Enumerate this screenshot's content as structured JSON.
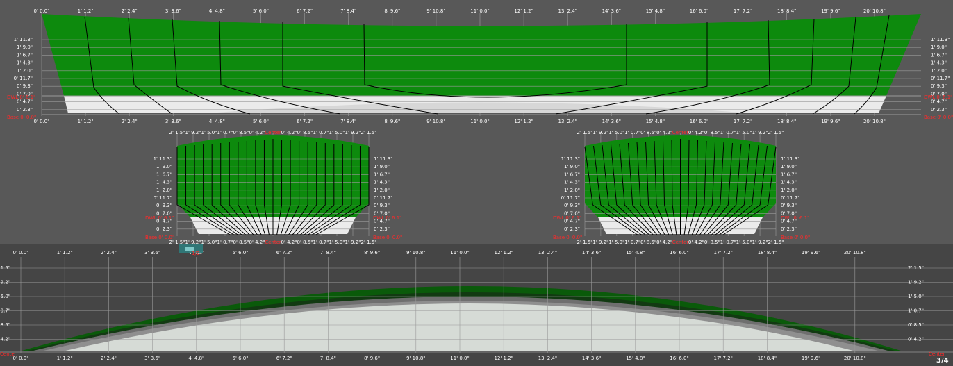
{
  "colors": {
    "background": "#585858",
    "plan_background": "#454545",
    "hull_above_water": "#0d8a0d",
    "hull_below_water": "#ebebeb",
    "plan_deck": "#0a5a0a",
    "plan_hull": "#d6dbd6",
    "grid": "#9a9a9a",
    "tick_text": "#ffffff",
    "reference_text": "#ff2a2a",
    "section_line": "#000000"
  },
  "profile_view": {
    "length_ticks": [
      "0' 0.0\"",
      "1' 1.2\"",
      "2' 2.4\"",
      "3' 3.6\"",
      "4' 4.8\"",
      "5' 6.0\"",
      "6' 7.2\"",
      "7' 8.4\"",
      "8' 9.6\"",
      "9' 10.8\"",
      "11' 0.0\"",
      "12' 1.2\"",
      "13' 2.4\"",
      "14' 3.6\"",
      "15' 4.8\"",
      "16' 6.0\"",
      "17' 7.2\"",
      "18' 8.4\"",
      "19' 9.6\"",
      "20' 10.8\""
    ],
    "height_ticks": [
      "1' 11.3\"",
      "1' 9.0\"",
      "1' 6.7\"",
      "1' 4.3\"",
      "1' 2.0\"",
      "0' 11.7\"",
      "0' 9.3\"",
      "0' 7.0\"",
      "0' 4.7\"",
      "0' 2.3\""
    ],
    "dwl_label": "DWL 0' 6.1\"",
    "base_label": "Base 0' 0.0\""
  },
  "section_views": [
    {
      "id": "front",
      "top_ticks": [
        "2' 1.5\"",
        "1' 9.2\"",
        "1' 5.0\"",
        "1' 0.7\"",
        "0' 8.5\"",
        "0' 4.2\"",
        "Center",
        "0' 4.2\"",
        "0' 8.5\"",
        "1' 0.7\"",
        "1' 5.0\"",
        "1' 9.2\"",
        "2' 1.5\""
      ],
      "height_ticks": [
        "1' 11.3\"",
        "1' 9.0\"",
        "1' 6.7\"",
        "1' 4.3\"",
        "1' 2.0\"",
        "0' 11.7\"",
        "0' 9.3\"",
        "0' 7.0\"",
        "0' 4.7\"",
        "0' 2.3\""
      ],
      "dwl_label": "DWL 0' 6.1\"",
      "base_label": "Base 0' 0.0\""
    },
    {
      "id": "rear",
      "top_ticks": [
        "2' 1.5\"",
        "1' 9.2\"",
        "1' 5.0\"",
        "1' 0.7\"",
        "0' 8.5\"",
        "0' 4.2\"",
        "Center",
        "0' 4.2\"",
        "0' 8.5\"",
        "1' 0.7\"",
        "1' 5.0\"",
        "1' 9.2\"",
        "2' 1.5\""
      ],
      "height_ticks": [
        "1' 11.3\"",
        "1' 9.0\"",
        "1' 6.7\"",
        "1' 4.3\"",
        "1' 2.0\"",
        "0' 11.7\"",
        "0' 9.3\"",
        "0' 7.0\"",
        "0' 4.7\"",
        "0' 2.3\""
      ],
      "dwl_label": "DWL 0' 6.1\"",
      "base_label": "Base 0' 0.0\""
    }
  ],
  "plan_view": {
    "length_ticks": [
      "0' 0.0\"",
      "1' 1.2\"",
      "2' 2.4\"",
      "3' 3.6\"",
      "4' 4.8\"",
      "5' 6.0\"",
      "6' 7.2\"",
      "7' 8.4\"",
      "8' 9.6\"",
      "9' 10.8\"",
      "11' 0.0\"",
      "12' 1.2\"",
      "13' 2.4\"",
      "14' 3.6\"",
      "15' 4.8\"",
      "16' 6.0\"",
      "17' 7.2\"",
      "18' 8.4\"",
      "19' 9.6\"",
      "20' 10.8\""
    ],
    "breadth_ticks": [
      "2' 1.5\"",
      "1' 9.2\"",
      "1' 5.0\"",
      "1' 0.7\"",
      "0' 8.5\"",
      "0' 4.2\""
    ],
    "axis_label": "Center",
    "corner_label": "3/4"
  }
}
